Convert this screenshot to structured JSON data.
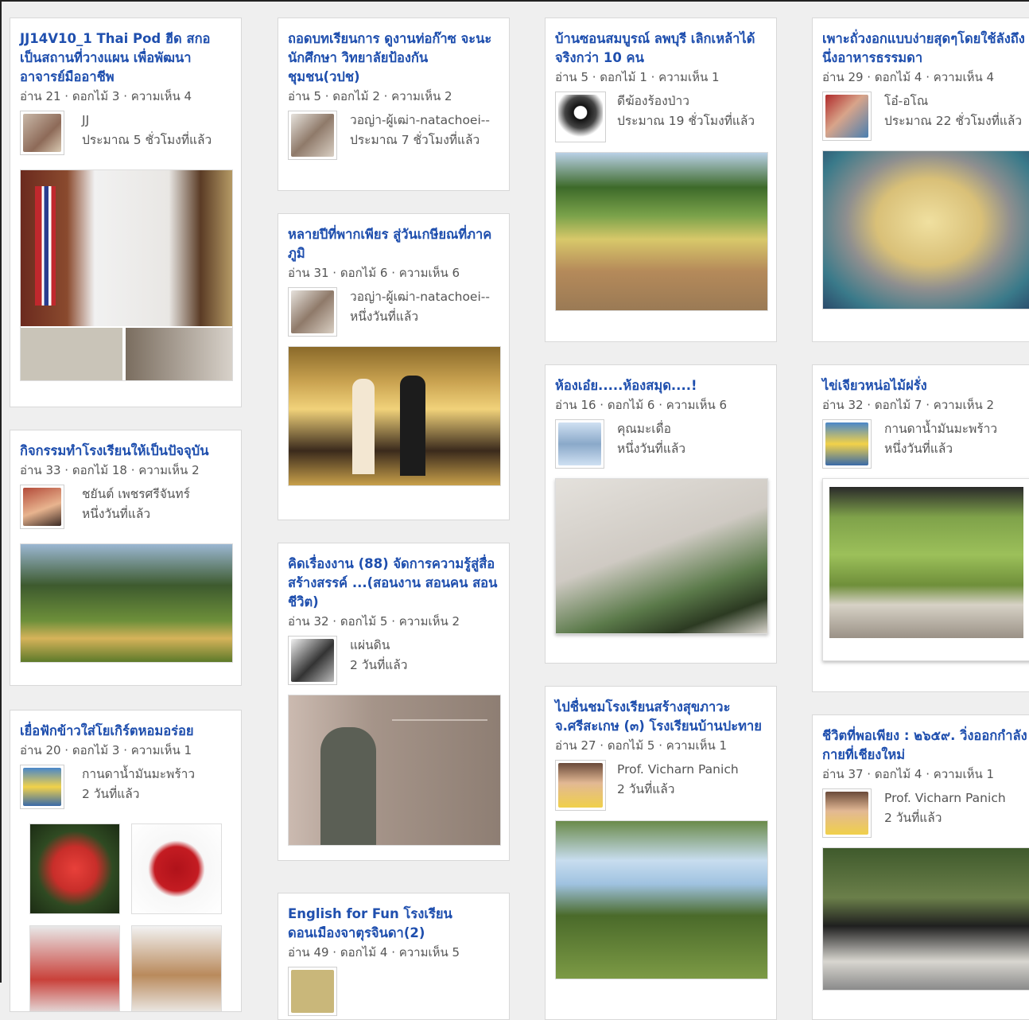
{
  "columns": [
    [
      {
        "title": "JJ14V10_1 Thai Pod ฮีด สกอ เป็นสถานที่วางแผน เพื่อพัฒนาอาจารย์มืออาชีพ",
        "stats": "อ่าน 21 · ดอกไม้ 3 · ความเห็น 4",
        "author": "JJ",
        "time": "ประมาณ 5 ชั่วโมงที่แล้ว"
      },
      {
        "title": "กิจกรรมทำโรงเรียนให้เป็นปัจจุบัน",
        "stats": "อ่าน 33 · ดอกไม้ 18 · ความเห็น 2",
        "author": "ชยันต์ เพชรศรีจันทร์",
        "time": "หนึ่งวันที่แล้ว"
      },
      {
        "title": "เยื่อฟักข้าวใส่โยเกิร์ตหอมอร่อย",
        "stats": "อ่าน 20 · ดอกไม้ 3 · ความเห็น 1",
        "author": "กานดาน้ำมันมะพร้าว",
        "time": "2 วันที่แล้ว"
      }
    ],
    [
      {
        "title": "ถอดบทเรียนการ ดูงานท่อก๊าซ จะนะ นักศึกษา วิทยาลัยป้องกันชุมชน(วปช)",
        "stats": "อ่าน 5 · ดอกไม้ 2 · ความเห็น 2",
        "author": "วอญ่า-ผู้เฒ่า-natachoei--",
        "time": "ประมาณ 7 ชั่วโมงที่แล้ว"
      },
      {
        "title": "หลายปีที่พากเพียร สู่วันเกษียณที่ภาคภูมิ",
        "stats": "อ่าน 31 · ดอกไม้ 6 · ความเห็น 6",
        "author": "วอญ่า-ผู้เฒ่า-natachoei--",
        "time": "หนึ่งวันที่แล้ว"
      },
      {
        "title": "คิดเรื่องงาน (88) จัดการความรู้สู่สื่อสร้างสรรค์ ...(สอนงาน สอนคน สอนชีวิต)",
        "stats": "อ่าน 32 · ดอกไม้ 5 · ความเห็น 2",
        "author": "แผ่นดิน",
        "time": "2 วันที่แล้ว"
      },
      {
        "title": "English for Fun โรงเรียนดอนเมืองจาตุรจินดา(2)",
        "stats": "อ่าน 49 · ดอกไม้ 4 · ความเห็น 5",
        "author": "",
        "time": ""
      }
    ],
    [
      {
        "title": "บ้านซอนสมบูรณ์ ลพบุรี เลิกเหล้าได้จริงกว่า 10 คน",
        "stats": "อ่าน 5 · ดอกไม้ 1 · ความเห็น 1",
        "author": "ดีฆ้องร้องป่าว",
        "time": "ประมาณ 19 ชั่วโมงที่แล้ว"
      },
      {
        "title": "ห้องเอ๋ย.....ห้องสมุด....!",
        "stats": "อ่าน 16 · ดอกไม้ 6 · ความเห็น 6",
        "author": "คุณมะเดื่อ",
        "time": "หนึ่งวันที่แล้ว"
      },
      {
        "title": "ไปชื่นชมโรงเรียนสร้างสุขภาวะ จ.ศรีสะเกษ (๓) โรงเรียนบ้านปะทาย",
        "stats": "อ่าน 27 · ดอกไม้ 5 · ความเห็น 1",
        "author": "Prof. Vicharn Panich",
        "time": "2 วันที่แล้ว"
      }
    ],
    [
      {
        "title": "เพาะถั่วงอกแบบง่ายสุดๆโดยใช้ลังถึงนึ่งอาหารธรรมดา",
        "stats": "อ่าน 29 · ดอกไม้ 4 · ความเห็น 4",
        "author": "โอ๋-อโณ",
        "time": "ประมาณ 22 ชั่วโมงที่แล้ว"
      },
      {
        "title": "ไข่เจียวหน่อไม้ฝรั่ง",
        "stats": "อ่าน 32 · ดอกไม้ 7 · ความเห็น 2",
        "author": "กานดาน้ำมันมะพร้าว",
        "time": "หนึ่งวันที่แล้ว"
      },
      {
        "title": "ชีวิตที่พอเพียง : ๒๖๕๙. วิ่งออกกำลังกายที่เชียงใหม่",
        "stats": "อ่าน 37 · ดอกไม้ 4 · ความเห็น 1",
        "author": "Prof. Vicharn Panich",
        "time": "2 วันที่แล้ว"
      }
    ]
  ]
}
